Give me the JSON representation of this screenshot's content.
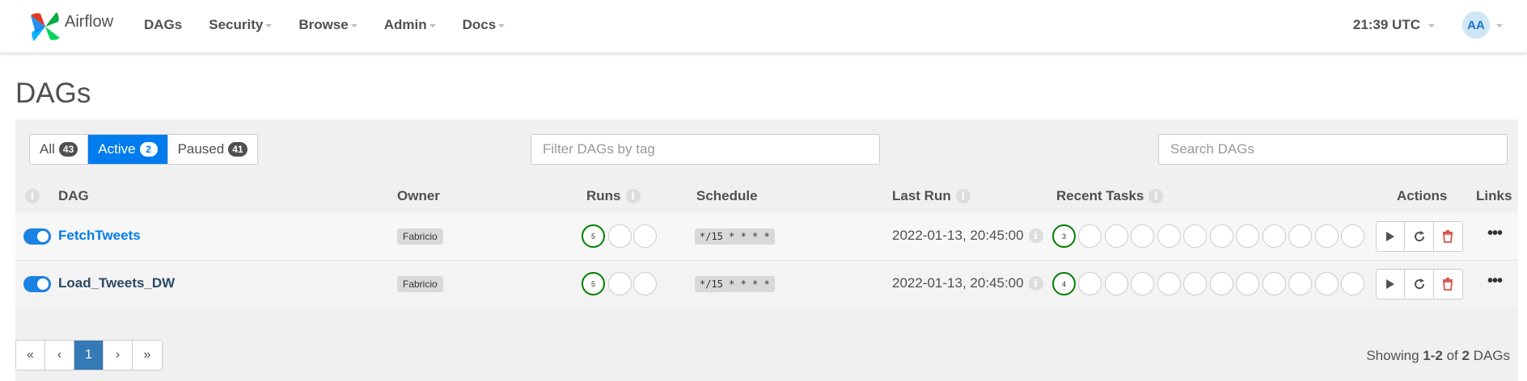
{
  "navbar": {
    "brand": "Airflow",
    "items": [
      {
        "label": "DAGs",
        "dropdown": false
      },
      {
        "label": "Security",
        "dropdown": true
      },
      {
        "label": "Browse",
        "dropdown": true
      },
      {
        "label": "Admin",
        "dropdown": true
      },
      {
        "label": "Docs",
        "dropdown": true
      }
    ],
    "clock": "21:39 UTC",
    "avatar": "AA"
  },
  "page": {
    "title": "DAGs"
  },
  "filters": {
    "all": {
      "label": "All",
      "count": "43"
    },
    "active": {
      "label": "Active",
      "count": "2"
    },
    "paused": {
      "label": "Paused",
      "count": "41"
    },
    "tag_placeholder": "Filter DAGs by tag",
    "search_placeholder": "Search DAGs"
  },
  "table": {
    "headers": {
      "dag": "DAG",
      "owner": "Owner",
      "runs": "Runs",
      "schedule": "Schedule",
      "last_run": "Last Run",
      "recent_tasks": "Recent Tasks",
      "actions": "Actions",
      "links": "Links"
    },
    "rows": [
      {
        "name": "FetchTweets",
        "owner": "Fabricio",
        "runs_success": "5",
        "schedule": "*/15 * * * *",
        "last_run": "2022-01-13, 20:45:00",
        "tasks_success": "3",
        "paused": false
      },
      {
        "name": "Load_Tweets_DW",
        "owner": "Fabricio",
        "runs_success": "5",
        "schedule": "*/15 * * * *",
        "last_run": "2022-01-13, 20:45:00",
        "tasks_success": "4",
        "paused": false
      }
    ]
  },
  "pagination": {
    "first": "«",
    "prev": "‹",
    "current": "1",
    "next": "›",
    "last": "»",
    "showing_prefix": "Showing ",
    "showing_range": "1-2",
    "showing_of": " of ",
    "showing_total": "2",
    "showing_suffix": " DAGs"
  },
  "colors": {
    "accent": "#017cee",
    "success": "#008000",
    "delete": "#d9534f"
  },
  "icons": {
    "trigger": "play-icon",
    "refresh": "refresh-icon",
    "delete": "trash-icon",
    "links": "ellipsis-icon",
    "info": "info-icon"
  }
}
